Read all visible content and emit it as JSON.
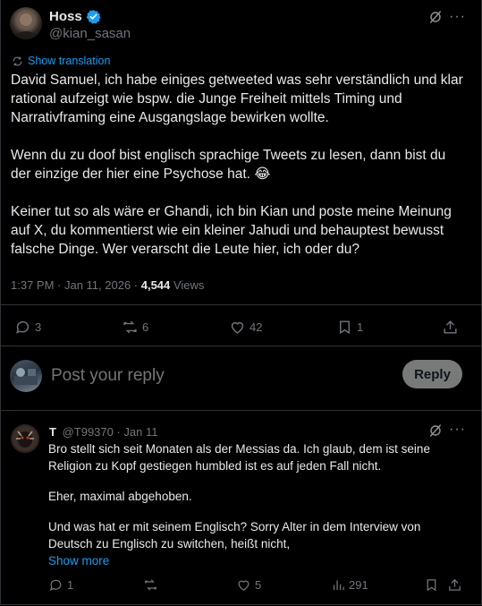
{
  "tweet": {
    "author_name": "Hoss",
    "author_handle": "@kian_sasan",
    "translate_label": "Show translation",
    "paragraphs": [
      "David Samuel, ich habe einiges getweeted was sehr verständlich und klar rational aufzeigt wie bspw. die Junge Freiheit mittels Timing und Narrativframing eine Ausgangslage bewirken wollte.",
      "Wenn du zu doof bist englisch sprachige Tweets zu lesen, dann bist du der einzige der hier eine Psychose hat. 😂",
      "Keiner tut so als wäre er Ghandi, ich bin Kian und poste meine Meinung auf X, du kommentierst wie ein kleiner Jahudi und behauptest bewusst falsche Dinge. Wer verarscht die Leute hier, ich oder du?"
    ],
    "timestamp": "1:37 PM · Jan 11, 2026 · ",
    "views_count": "4,544",
    "views_label": " Views",
    "replies": "3",
    "reposts": "6",
    "likes": "42",
    "bookmarks": "1"
  },
  "composer": {
    "placeholder": "Post your reply",
    "reply_label": "Reply"
  },
  "reply": {
    "author_name": "T",
    "handle_time": "@T99370 · Jan 11",
    "paragraphs": [
      "Bro stellt sich seit Monaten als der Messias da. Ich glaub, dem ist seine Religion zu Kopf gestiegen humbled ist es auf jeden Fall nicht.",
      "Eher, maximal abgehoben.",
      "Und was hat er mit seinem Englisch? Sorry Alter in dem Interview von Deutsch zu Englisch zu switchen, heißt nicht,"
    ],
    "show_more": "Show more",
    "replies": "1",
    "likes": "5",
    "views": "291"
  },
  "colors": {
    "background": "#000000",
    "text": "#e7e9ea",
    "muted": "#71767b",
    "accent": "#1d9bf0",
    "divider": "#2f3336",
    "reply_button": "#787a7a"
  }
}
